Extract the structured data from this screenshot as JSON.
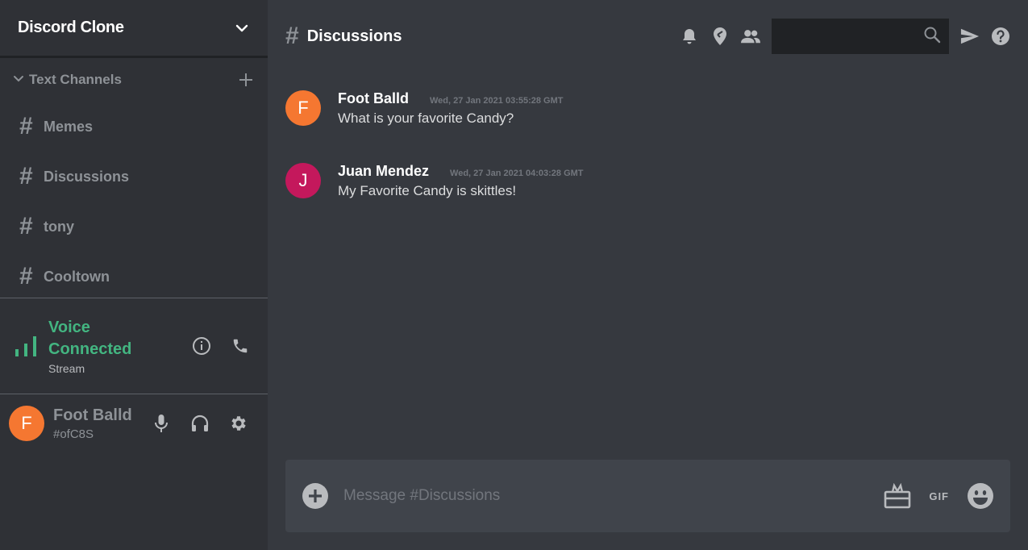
{
  "server": {
    "name": "Discord Clone"
  },
  "channels_section": {
    "title": "Text Channels"
  },
  "channels": [
    {
      "hash": "#",
      "label": "Memes"
    },
    {
      "hash": "#",
      "label": "Discussions"
    },
    {
      "hash": "#",
      "label": "tony"
    },
    {
      "hash": "#",
      "label": "Cooltown"
    }
  ],
  "voice": {
    "status": "Voice Connected",
    "sub": "Stream",
    "status_color": "#43b581"
  },
  "user": {
    "name": "Foot Balld",
    "tag": "#ofC8S",
    "avatar_letter": "F",
    "avatar_color": "#f57731"
  },
  "topbar": {
    "hash": "#",
    "title": "Discussions"
  },
  "messages": [
    {
      "avatar_letter": "F",
      "avatar_color": "#f57731",
      "author": "Foot Balld",
      "time": "Wed, 27 Jan 2021 03:55:28 GMT",
      "text": "What is your favorite Candy?"
    },
    {
      "avatar_letter": "J",
      "avatar_color": "#c4185c",
      "author": "Juan Mendez",
      "time": "Wed, 27 Jan 2021 04:03:28 GMT",
      "text": "My Favorite Candy is skittles!"
    }
  ],
  "composer": {
    "placeholder": "Message #Discussions",
    "gif_label": "GIF"
  },
  "icons": {
    "server_menu": "chevron-down-icon",
    "add_channel": "plus-icon",
    "voice_signal": "signal-bars-icon",
    "voice_info": "info-icon",
    "voice_disconnect": "phone-icon",
    "mic": "microphone-icon",
    "headphones": "headphones-icon",
    "settings": "gear-icon",
    "bell": "bell-icon",
    "pin": "pin-icon",
    "members": "members-icon",
    "search": "search-icon",
    "send": "send-icon",
    "help": "help-icon",
    "composer_add": "add-circle-icon",
    "gift": "gift-icon",
    "emoji": "emoji-icon"
  }
}
